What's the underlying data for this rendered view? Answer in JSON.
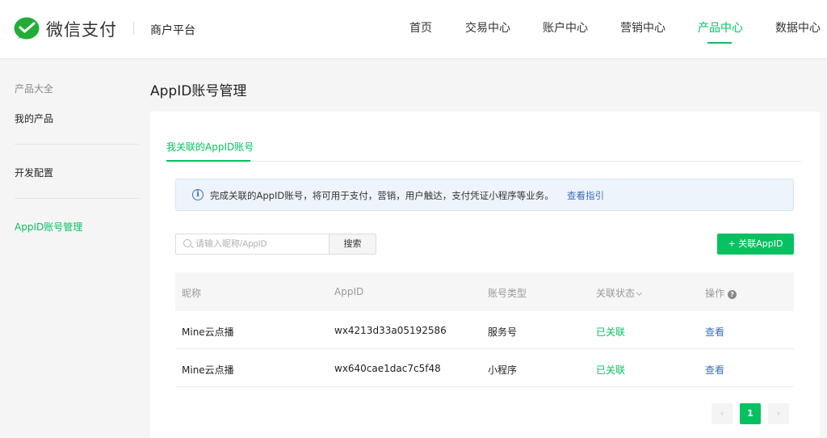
{
  "header": {
    "logo_text": "微信支付",
    "platform": "商户平台",
    "nav": [
      {
        "label": "首页",
        "active": false
      },
      {
        "label": "交易中心",
        "active": false
      },
      {
        "label": "账户中心",
        "active": false
      },
      {
        "label": "营销中心",
        "active": false
      },
      {
        "label": "产品中心",
        "active": true
      },
      {
        "label": "数据中心",
        "active": false
      }
    ]
  },
  "sidebar": {
    "title": "产品大全",
    "items": [
      {
        "label": "我的产品",
        "active": false
      },
      {
        "label": "开发配置",
        "active": false
      },
      {
        "label": "AppID账号管理",
        "active": true
      }
    ]
  },
  "main": {
    "page_title": "AppID账号管理",
    "tab_label": "我关联的AppID账号",
    "notice": {
      "icon": "info-icon",
      "text": "完成关联的AppID账号，将可用于支付，营销，用户触达，支付凭证小程序等业务。",
      "link": "查看指引"
    },
    "search": {
      "placeholder": "请输入昵称/AppID",
      "value": "",
      "button": "搜索"
    },
    "add_button": "+ 关联AppID",
    "table": {
      "columns": [
        "昵称",
        "AppID",
        "账号类型",
        "关联状态",
        "操作"
      ],
      "rows": [
        {
          "nickname": "Mine云点播",
          "appid": "wx4213d33a05192586",
          "type": "服务号",
          "status": "已关联",
          "action": "查看"
        },
        {
          "nickname": "Mine云点播",
          "appid": "wx640cae1dac7c5f48",
          "type": "小程序",
          "status": "已关联",
          "action": "查看"
        }
      ]
    },
    "pagination": {
      "prev": "‹",
      "current": "1",
      "next": "›"
    }
  },
  "colors": {
    "accent": "#07c160",
    "link": "#3a6db8"
  }
}
